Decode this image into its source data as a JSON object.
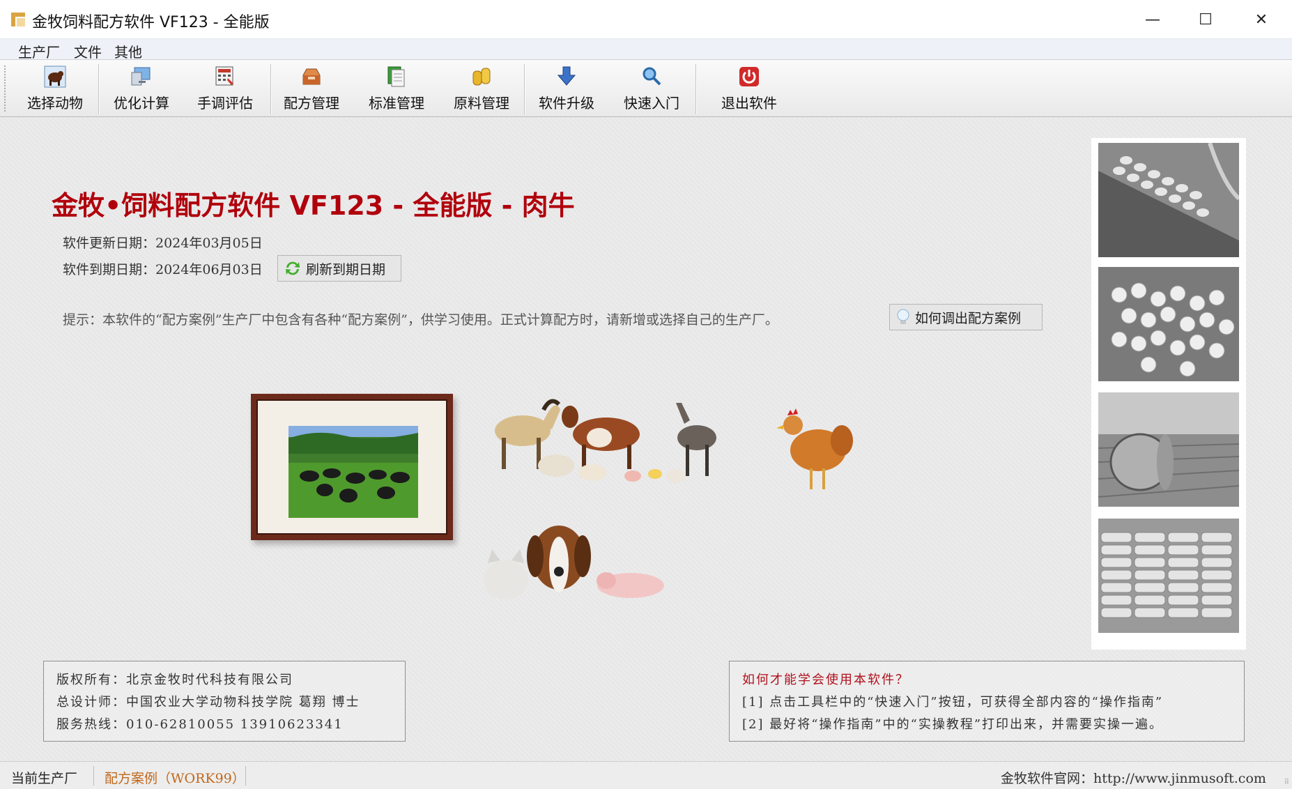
{
  "window": {
    "title": "金牧饲料配方软件 VF123 - 全能版",
    "minimize": "—",
    "maximize": "☐",
    "close": "✕"
  },
  "menu": [
    "生产厂",
    "文件",
    "其他"
  ],
  "toolbar": [
    {
      "label": "选择动物",
      "icon": "cow-icon"
    },
    {
      "label": "优化计算",
      "icon": "computer-icon"
    },
    {
      "label": "手调评估",
      "icon": "calculator-icon"
    },
    {
      "label": "配方管理",
      "icon": "inbox-icon"
    },
    {
      "label": "标准管理",
      "icon": "document-icon"
    },
    {
      "label": "原料管理",
      "icon": "coins-icon"
    },
    {
      "label": "软件升级",
      "icon": "download-arrow-icon"
    },
    {
      "label": "快速入门",
      "icon": "search-icon"
    },
    {
      "label": "退出软件",
      "icon": "power-icon"
    }
  ],
  "main": {
    "heading": "金牧•饲料配方软件 VF123 - 全能版 - 肉牛",
    "update_date": "软件更新日期：2024年03月05日",
    "expire_date": "软件到期日期：2024年06月03日",
    "refresh_button": "刷新到期日期",
    "hint": "提示：本软件的“配方案例”生产厂中包含有各种“配方案例”，供学习使用。正式计算配方时，请新增或选择自己的生产厂。",
    "case_button": "如何调出配方案例"
  },
  "copyright_box": {
    "line1": "版权所有：北京金牧时代科技有限公司",
    "line2": "总设计师：中国农业大学动物科技学院  葛翔  博士",
    "line3": "服务热线：010-62810055   13910623341"
  },
  "help_box": {
    "title": "如何才能学会使用本软件？",
    "line1": "[1] 点击工具栏中的“快速入门”按钮，可获得全部内容的“操作指南”",
    "line2": "[2] 最好将“操作指南”中的“实操教程”打印出来，并需要实操一遍。"
  },
  "status": {
    "label": "当前生产厂",
    "factory": "配方案例（WORK99）",
    "website": "金牧软件官网：http://www.jinmusoft.com"
  },
  "colors": {
    "heading": "#b0000c",
    "factory": "#c0681c",
    "help_title": "#b0101c"
  }
}
